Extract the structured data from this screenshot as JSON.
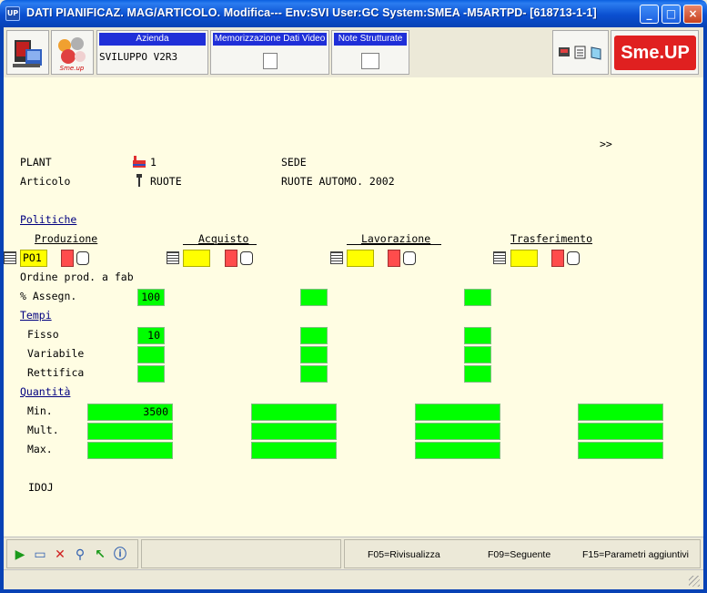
{
  "window": {
    "title": "DATI PIANIFICAZ. MAG/ARTICOLO.  Modifica--- Env:SVI User:GC System:SMEA -M5ARTPD- [618713-1-1]",
    "app_icon": "UP"
  },
  "toolbar": {
    "azienda_label": "Azienda",
    "azienda_value": "SVILUPPO V2R3",
    "memo_label": "Memorizzazione Dati Video",
    "note_label": "Note Strutturate",
    "brand": "Sme.UP"
  },
  "header": {
    "more": ">>",
    "plant_label": "PLANT",
    "plant_value": "1",
    "sede_label": "SEDE",
    "articolo_label": "Articolo",
    "articolo_value": "RUOTE",
    "articolo_desc": "RUOTE AUTOMO. 2002"
  },
  "sections": {
    "politiche": "Politiche",
    "tempi": "Tempi",
    "quantita": "Quantità"
  },
  "columns": [
    "Produzione",
    "Acquisto",
    "Lavorazione",
    "Trasferimento"
  ],
  "policy": {
    "produzione_code": "PO1",
    "ordine_desc": "Ordine prod. a fab"
  },
  "rows": {
    "assegn_label": "% Assegn.",
    "assegn_values": [
      "100",
      "",
      ""
    ],
    "fisso_label": "Fisso",
    "fisso_values": [
      "10",
      "",
      ""
    ],
    "variabile_label": "Variabile",
    "rettifica_label": "Rettifica",
    "min_label": "Min.",
    "min_values": [
      "3500",
      "",
      "",
      ""
    ],
    "mult_label": "Mult.",
    "max_label": "Max."
  },
  "footer_code": "IDOJ",
  "statusbar": {
    "f05": "F05=Rivisualizza",
    "f09": "F09=Seguente",
    "f15": "F15=Parametri aggiuntivi"
  },
  "colors": {
    "field_green": "#00ff00",
    "field_yellow": "#ffff00",
    "field_red": "#ff4c4c",
    "background": "#fffde3",
    "titlebar": "#0a4fd0"
  }
}
